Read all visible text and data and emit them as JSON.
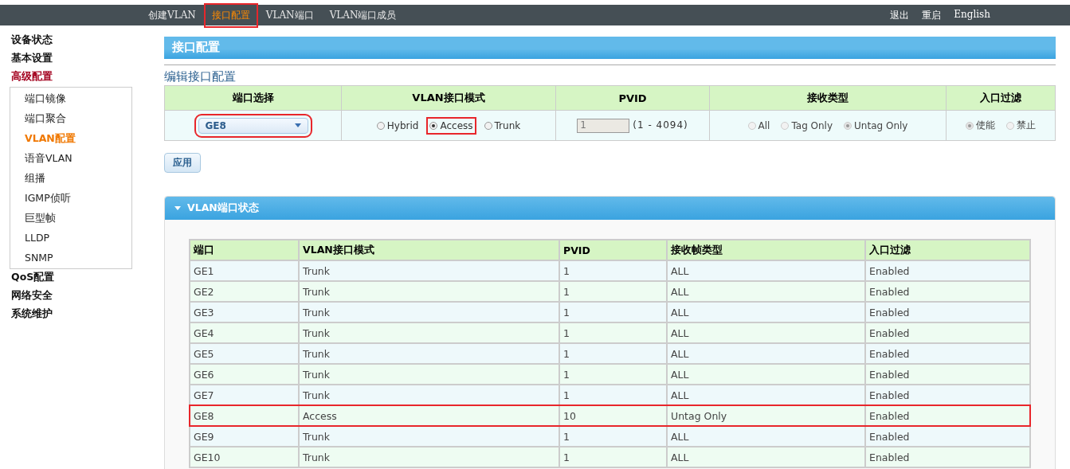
{
  "top_nav": {
    "tabs": [
      {
        "label": "创建VLAN",
        "selected": false,
        "highlighted": false
      },
      {
        "label": "接口配置",
        "selected": true,
        "highlighted": true
      },
      {
        "label": "VLAN端口",
        "selected": false,
        "highlighted": false
      },
      {
        "label": "VLAN端口成员",
        "selected": false,
        "highlighted": false
      }
    ],
    "links": [
      "退出",
      "重启",
      "English"
    ]
  },
  "sidebar": {
    "items": [
      {
        "label": "设备状态",
        "selected": false
      },
      {
        "label": "基本设置",
        "selected": false
      },
      {
        "label": "高级配置",
        "selected": true,
        "expanded": true,
        "children": [
          {
            "label": "端口镜像",
            "selected": false
          },
          {
            "label": "端口聚合",
            "selected": false
          },
          {
            "label": "VLAN配置",
            "selected": true
          },
          {
            "label": "语音VLAN",
            "selected": false
          },
          {
            "label": "组播",
            "selected": false
          },
          {
            "label": "IGMP侦听",
            "selected": false
          },
          {
            "label": "巨型帧",
            "selected": false
          },
          {
            "label": "LLDP",
            "selected": false
          },
          {
            "label": "SNMP",
            "selected": false
          }
        ]
      },
      {
        "label": "QoS配置",
        "selected": false
      },
      {
        "label": "网络安全",
        "selected": false
      },
      {
        "label": "系统维护",
        "selected": false
      }
    ]
  },
  "page_title": "接口配置",
  "edit_section": {
    "title": "编辑接口配置",
    "columns": [
      "端口选择",
      "VLAN接口模式",
      "PVID",
      "接收类型",
      "入口过滤"
    ],
    "port_select": {
      "value": "GE8",
      "highlighted": true
    },
    "mode_options": [
      {
        "label": "Hybrid",
        "selected": false,
        "highlighted": false
      },
      {
        "label": "Access",
        "selected": true,
        "highlighted": true
      },
      {
        "label": "Trunk",
        "selected": false,
        "highlighted": false
      }
    ],
    "pvid": {
      "value": "1",
      "disabled": true
    },
    "pvid_range": "(1 - 4094)",
    "accept_options": [
      {
        "label": "All",
        "selected": false,
        "disabled": true
      },
      {
        "label": "Tag Only",
        "selected": false,
        "disabled": true
      },
      {
        "label": "Untag Only",
        "selected": true,
        "disabled": true
      }
    ],
    "filter_options": [
      {
        "label": "使能",
        "selected": true,
        "disabled": true
      },
      {
        "label": "禁止",
        "selected": false,
        "disabled": true
      }
    ],
    "apply_button": "应用"
  },
  "status_section": {
    "title": "VLAN端口状态",
    "expanded": true,
    "columns": [
      "端口",
      "VLAN接口模式",
      "PVID",
      "接收帧类型",
      "入口过滤"
    ],
    "rows": [
      {
        "cells": [
          "GE1",
          "Trunk",
          "1",
          "ALL",
          "Enabled"
        ],
        "highlighted": false
      },
      {
        "cells": [
          "GE2",
          "Trunk",
          "1",
          "ALL",
          "Enabled"
        ],
        "highlighted": false
      },
      {
        "cells": [
          "GE3",
          "Trunk",
          "1",
          "ALL",
          "Enabled"
        ],
        "highlighted": false
      },
      {
        "cells": [
          "GE4",
          "Trunk",
          "1",
          "ALL",
          "Enabled"
        ],
        "highlighted": false
      },
      {
        "cells": [
          "GE5",
          "Trunk",
          "1",
          "ALL",
          "Enabled"
        ],
        "highlighted": false
      },
      {
        "cells": [
          "GE6",
          "Trunk",
          "1",
          "ALL",
          "Enabled"
        ],
        "highlighted": false
      },
      {
        "cells": [
          "GE7",
          "Trunk",
          "1",
          "ALL",
          "Enabled"
        ],
        "highlighted": false
      },
      {
        "cells": [
          "GE8",
          "Access",
          "10",
          "Untag Only",
          "Enabled"
        ],
        "highlighted": true
      },
      {
        "cells": [
          "GE9",
          "Trunk",
          "1",
          "ALL",
          "Enabled"
        ],
        "highlighted": false
      },
      {
        "cells": [
          "GE10",
          "Trunk",
          "1",
          "ALL",
          "Enabled"
        ],
        "highlighted": false
      }
    ]
  }
}
